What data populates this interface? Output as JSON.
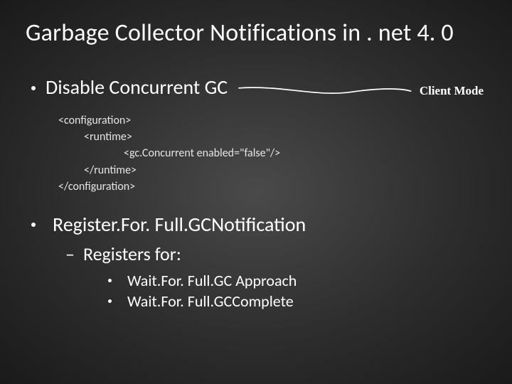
{
  "title": "Garbage Collector Notifications in . net 4. 0",
  "bullet1": "Disable Concurrent GC",
  "callout": "Client Mode",
  "code": {
    "l1": "<configuration>",
    "l2": "<runtime>",
    "l3": "<gc.Concurrent enabled=\"false\"/>",
    "l4": "</runtime>",
    "l5": "</configuration>"
  },
  "bullet2": "Register.For. Full.GCNotification",
  "sub": "Registers for:",
  "items": {
    "a": "Wait.For. Full.GC Approach",
    "b": "Wait.For. Full.GCComplete"
  }
}
